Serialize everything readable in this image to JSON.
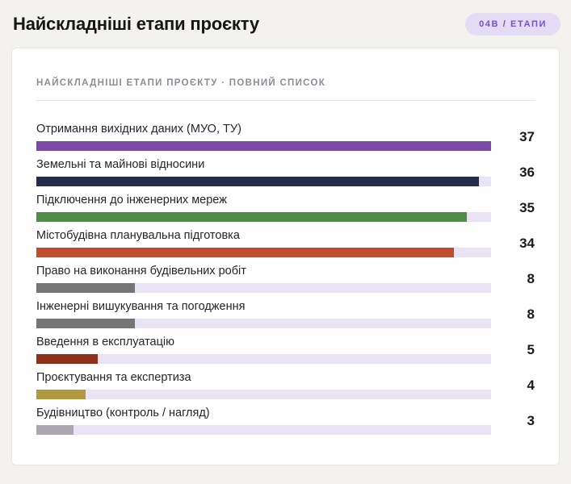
{
  "header": {
    "title": "Найскладніші етапи проєкту",
    "badge_label": "04B / ЕТАПИ"
  },
  "card": {
    "subtitle": "НАЙСКЛАДНІШІ ЕТАПИ ПРОЄКТУ · ПОВНИЙ СПИСОК"
  },
  "colors": {
    "page_background": "#F3F2EF",
    "card_background": "#FFFFFF",
    "badge_background": "#E4DCF4",
    "badge_text": "#7B4EC6",
    "bar_track": "#E9E3F5",
    "accent_purple": "#7A4AA6"
  },
  "chart_data": {
    "type": "bar",
    "orientation": "horizontal",
    "title": "Найскладніші етапи проєкту · повний список",
    "legend": "none",
    "grid": false,
    "value_axis_max": 37,
    "categories": [
      "Отримання вихідних даних (МУО, ТУ)",
      "Земельні та майнові відносини",
      "Підключення до інженерних мереж",
      "Містобудівна планувальна підготовка",
      "Право на виконання будівельних робіт",
      "Інженерні вишукування та погодження",
      "Введення в експлуатацію",
      "Проєктування та експертиза",
      "Будівництво (контроль / нагляд)"
    ],
    "values": [
      37,
      36,
      35,
      34,
      8,
      8,
      5,
      4,
      3
    ],
    "bar_colors": [
      "#7A4AA6",
      "#232C4D",
      "#4F8C49",
      "#C04B2E",
      "#757575",
      "#757575",
      "#8F3118",
      "#B09A3D",
      "#ACA6B1"
    ],
    "track_color": "#E9E3F5"
  }
}
